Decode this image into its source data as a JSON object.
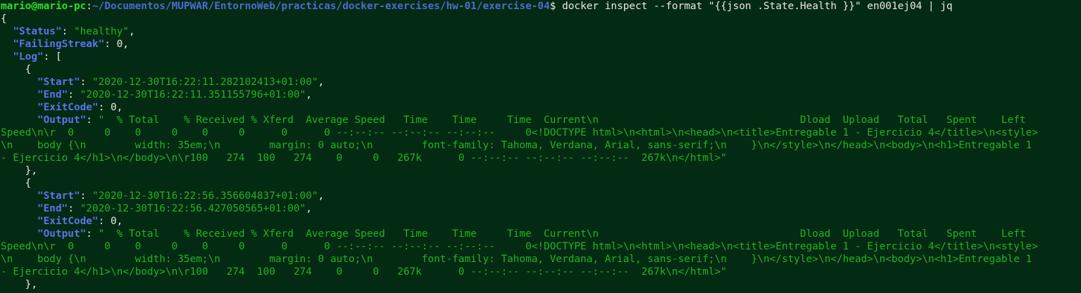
{
  "prompt": {
    "user_host": "mario@mario-pc",
    "sep": ":",
    "cwd": "~/Documentos/MUPWAR/EntornoWeb/practicas/docker-exercises/hw-01/exercise-04",
    "symbol": "$",
    "command": " docker inspect --format \"{{json .State.Health }}\" en001ej04 | jq"
  },
  "output": {
    "open_brace": "{",
    "status_key": "\"Status\"",
    "status_value": "\"healthy\"",
    "failing_key": "\"FailingStreak\"",
    "failing_value": "0",
    "log_key": "\"Log\"",
    "entries": [
      {
        "start_key": "\"Start\"",
        "start_value": "\"2020-12-30T16:22:11.282102413+01:00\"",
        "end_key": "\"End\"",
        "end_value": "\"2020-12-30T16:22:11.351155796+01:00\"",
        "exit_key": "\"ExitCode\"",
        "exit_value": "0",
        "output_key": "\"Output\"",
        "output_lines": [
          "\"  % Total    % Received % Xferd  Average Speed   Time    Time     Time  Current\\n                                 Dload  Upload   Total   Spent    Left",
          "Speed\\n\\r  0     0    0     0    0     0      0      0 --:--:-- --:--:-- --:--:--     0<!DOCTYPE html>\\n<html>\\n<head>\\n<title>Entregable 1 - Ejercicio 4</title>\\n<style>",
          "\\n    body {\\n        width: 35em;\\n        margin: 0 auto;\\n        font-family: Tahoma, Verdana, Arial, sans-serif;\\n    }\\n</style>\\n</head>\\n<body>\\n<h1>Entregable 1",
          "- Ejercicio 4</h1>\\n</body>\\n\\r100   274  100   274    0     0   267k      0 --:--:-- --:--:-- --:--:--  267k\\n</html>\""
        ]
      },
      {
        "start_key": "\"Start\"",
        "start_value": "\"2020-12-30T16:22:56.356604837+01:00\"",
        "end_key": "\"End\"",
        "end_value": "\"2020-12-30T16:22:56.427050565+01:00\"",
        "exit_key": "\"ExitCode\"",
        "exit_value": "0",
        "output_key": "\"Output\"",
        "output_lines": [
          "\"  % Total    % Received % Xferd  Average Speed   Time    Time     Time  Current\\n                                 Dload  Upload   Total   Spent    Left",
          "Speed\\n\\r  0     0    0     0    0     0      0      0 --:--:-- --:--:-- --:--:--     0<!DOCTYPE html>\\n<html>\\n<head>\\n<title>Entregable 1 - Ejercicio 4</title>\\n<style>",
          "\\n    body {\\n        width: 35em;\\n        margin: 0 auto;\\n        font-family: Tahoma, Verdana, Arial, sans-serif;\\n    }\\n</style>\\n</head>\\n<body>\\n<h1>Entregable 1",
          "- Ejercicio 4</h1>\\n</body>\\n\\r100   274  100   274    0     0   267k      0 --:--:-- --:--:-- --:--:--  267k\\n</html>\""
        ]
      }
    ]
  },
  "colors": {
    "background": "#032a12",
    "user_host": "#2ce02c",
    "path": "#4a6cd4",
    "json_key": "#5b74ee",
    "json_string": "#24b324",
    "plain_text": "#e9e9e9"
  }
}
